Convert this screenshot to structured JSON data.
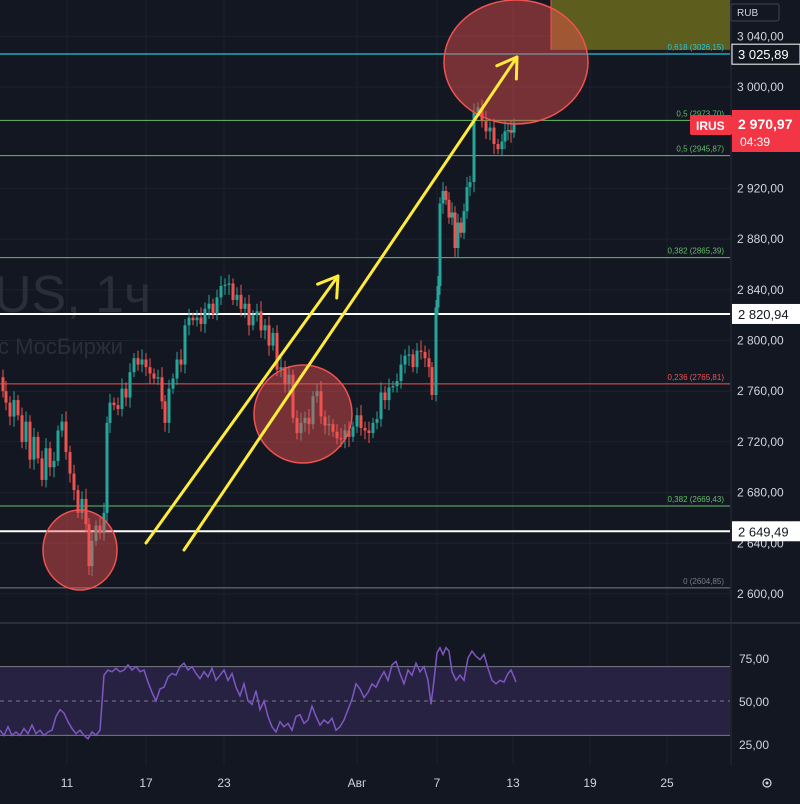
{
  "currency_badge": "RUB",
  "watermark": {
    "line1": "US, 1ч",
    "line2": "с МосБиржи"
  },
  "settings_icon": "gear-icon",
  "ticker": {
    "symbol": "IRUS",
    "price": "2 970,97",
    "countdown": "04:39"
  },
  "colors": {
    "background": "#131722",
    "bull": "#26a69a",
    "bear": "#ef5350",
    "grid": "#1e222d",
    "rsi": "#7e57c2",
    "rsi_band": "#2a2346",
    "arrow": "#ffeb3b",
    "circle_fill": "rgba(239,83,80,0.45)",
    "circle_stroke": "#ef5350",
    "target_box": "#6b6a1c"
  },
  "chart_data": [
    {
      "type": "candlestick",
      "title": "",
      "currency": "RUB",
      "x_tick_labels": [
        "11",
        "17",
        "23",
        "Авг",
        "7",
        "13",
        "19",
        "25"
      ],
      "y_axis": {
        "range": [
          2585,
          3060
        ],
        "tick_values": [
          2600,
          2640,
          2680,
          2720,
          2760,
          2800,
          2840,
          2880,
          2920,
          3000,
          3040
        ],
        "tick_labels": [
          "2 600,00",
          "2 640,00",
          "2 680,00",
          "2 720,00",
          "2 760,00",
          "2 800,00",
          "2 840,00",
          "2 880,00",
          "2 920,00",
          "3 000,00",
          "3 040,00"
        ]
      },
      "horizontal_levels": [
        {
          "value": 3025.89,
          "label": "3 025,89",
          "color": "#26c6da"
        },
        {
          "value": 2820.94,
          "label": "2 820,94",
          "color": "#ffffff"
        },
        {
          "value": 2649.49,
          "label": "2 649,49",
          "color": "#ffffff"
        }
      ],
      "fib_levels": [
        {
          "value": 3026.15,
          "label": "0,618 (3026,15)",
          "color": "#26c6da"
        },
        {
          "value": 2973.7,
          "label": "0,5 (2973,70)",
          "color": "#66bb6a"
        },
        {
          "value": 2945.87,
          "label": "0,5 (2945,87)",
          "color": "#66bb6a"
        },
        {
          "value": 2865.39,
          "label": "0,382 (2865,39)",
          "color": "#66bb6a"
        },
        {
          "value": 2765.81,
          "label": "0,236 (2765,81)",
          "color": "#ef5350"
        },
        {
          "value": 2669.43,
          "label": "0,382 (2669,43)",
          "color": "#66bb6a"
        },
        {
          "value": 2604.85,
          "label": "0 (2604,85)",
          "color": "#787b86"
        }
      ],
      "last_price": 2970.97,
      "price_path": [
        [
          0,
          2771
        ],
        [
          3,
          2760
        ],
        [
          6,
          2751
        ],
        [
          10,
          2740
        ],
        [
          14,
          2753
        ],
        [
          18,
          2741
        ],
        [
          22,
          2720
        ],
        [
          26,
          2736
        ],
        [
          30,
          2706
        ],
        [
          34,
          2724
        ],
        [
          38,
          2707
        ],
        [
          42,
          2690
        ],
        [
          46,
          2715
        ],
        [
          50,
          2700
        ],
        [
          54,
          2705
        ],
        [
          58,
          2729
        ],
        [
          62,
          2736
        ],
        [
          66,
          2712
        ],
        [
          70,
          2695
        ],
        [
          74,
          2682
        ],
        [
          78,
          2664
        ],
        [
          82,
          2675
        ],
        [
          86,
          2655
        ],
        [
          89,
          2622
        ],
        [
          92,
          2642
        ],
        [
          96,
          2654
        ],
        [
          100,
          2648
        ],
        [
          104,
          2664
        ],
        [
          107,
          2735
        ],
        [
          110,
          2751
        ],
        [
          114,
          2749
        ],
        [
          118,
          2746
        ],
        [
          122,
          2762
        ],
        [
          126,
          2755
        ],
        [
          130,
          2775
        ],
        [
          134,
          2786
        ],
        [
          138,
          2781
        ],
        [
          142,
          2785
        ],
        [
          146,
          2779
        ],
        [
          150,
          2774
        ],
        [
          154,
          2770
        ],
        [
          158,
          2771
        ],
        [
          162,
          2752
        ],
        [
          165,
          2735
        ],
        [
          169,
          2762
        ],
        [
          173,
          2770
        ],
        [
          177,
          2785
        ],
        [
          181,
          2781
        ],
        [
          185,
          2812
        ],
        [
          189,
          2818
        ],
        [
          193,
          2816
        ],
        [
          197,
          2818
        ],
        [
          201,
          2813
        ],
        [
          205,
          2825
        ],
        [
          209,
          2829
        ],
        [
          213,
          2821
        ],
        [
          217,
          2834
        ],
        [
          221,
          2843
        ],
        [
          225,
          2844
        ],
        [
          229,
          2845
        ],
        [
          233,
          2832
        ],
        [
          237,
          2836
        ],
        [
          241,
          2825
        ],
        [
          245,
          2829
        ],
        [
          249,
          2812
        ],
        [
          253,
          2820
        ],
        [
          257,
          2823
        ],
        [
          261,
          2808
        ],
        [
          265,
          2812
        ],
        [
          269,
          2796
        ],
        [
          273,
          2806
        ],
        [
          277,
          2777
        ],
        [
          281,
          2779
        ],
        [
          285,
          2766
        ],
        [
          289,
          2773
        ],
        [
          293,
          2739
        ],
        [
          297,
          2727
        ],
        [
          301,
          2735
        ],
        [
          305,
          2739
        ],
        [
          309,
          2734
        ],
        [
          313,
          2756
        ],
        [
          317,
          2760
        ],
        [
          321,
          2740
        ],
        [
          325,
          2733
        ],
        [
          329,
          2734
        ],
        [
          333,
          2728
        ],
        [
          337,
          2723
        ],
        [
          341,
          2722
        ],
        [
          345,
          2729
        ],
        [
          349,
          2724
        ],
        [
          353,
          2732
        ],
        [
          357,
          2741
        ],
        [
          361,
          2731
        ],
        [
          365,
          2729
        ],
        [
          369,
          2727
        ],
        [
          373,
          2735
        ],
        [
          377,
          2738
        ],
        [
          381,
          2759
        ],
        [
          385,
          2753
        ],
        [
          389,
          2763
        ],
        [
          393,
          2764
        ],
        [
          397,
          2768
        ],
        [
          401,
          2781
        ],
        [
          405,
          2788
        ],
        [
          409,
          2789
        ],
        [
          413,
          2779
        ],
        [
          417,
          2792
        ],
        [
          421,
          2791
        ],
        [
          425,
          2786
        ],
        [
          429,
          2779
        ],
        [
          432,
          2757
        ],
        [
          436,
          2826
        ],
        [
          438,
          2843
        ],
        [
          440,
          2908
        ],
        [
          443,
          2918
        ],
        [
          446,
          2911
        ],
        [
          449,
          2897
        ],
        [
          452,
          2901
        ],
        [
          455,
          2873
        ],
        [
          458,
          2893
        ],
        [
          461,
          2885
        ],
        [
          464,
          2902
        ],
        [
          467,
          2921
        ],
        [
          470,
          2925
        ],
        [
          474,
          2980
        ],
        [
          478,
          2984
        ],
        [
          482,
          2973
        ],
        [
          486,
          2965
        ],
        [
          490,
          2968
        ],
        [
          494,
          2955
        ],
        [
          498,
          2951
        ],
        [
          502,
          2957
        ],
        [
          505,
          2965
        ],
        [
          508,
          2966
        ],
        [
          511,
          2964
        ],
        [
          514,
          2971
        ]
      ]
    },
    {
      "type": "line",
      "title": "",
      "series": [
        {
          "values": [
            [
              0,
              33
            ],
            [
              4,
              30
            ],
            [
              8,
              35
            ],
            [
              12,
              30
            ],
            [
              16,
              32
            ],
            [
              20,
              30
            ],
            [
              24,
              34
            ],
            [
              28,
              31
            ],
            [
              32,
              36
            ],
            [
              36,
              31
            ],
            [
              40,
              33
            ],
            [
              44,
              30
            ],
            [
              48,
              32
            ],
            [
              52,
              33
            ],
            [
              56,
              41
            ],
            [
              60,
              45
            ],
            [
              64,
              43
            ],
            [
              68,
              38
            ],
            [
              72,
              34
            ],
            [
              76,
              31
            ],
            [
              80,
              33
            ],
            [
              84,
              30
            ],
            [
              88,
              28
            ],
            [
              92,
              32
            ],
            [
              96,
              30
            ],
            [
              100,
              33
            ],
            [
              104,
              65
            ],
            [
              108,
              68
            ],
            [
              112,
              67
            ],
            [
              116,
              69
            ],
            [
              120,
              67
            ],
            [
              124,
              68
            ],
            [
              128,
              71
            ],
            [
              132,
              68
            ],
            [
              136,
              70
            ],
            [
              140,
              67
            ],
            [
              144,
              68
            ],
            [
              148,
              61
            ],
            [
              152,
              55
            ],
            [
              156,
              50
            ],
            [
              160,
              57
            ],
            [
              164,
              58
            ],
            [
              168,
              64
            ],
            [
              172,
              66
            ],
            [
              176,
              65
            ],
            [
              180,
              70
            ],
            [
              184,
              72
            ],
            [
              188,
              68
            ],
            [
              192,
              70
            ],
            [
              196,
              66
            ],
            [
              200,
              63
            ],
            [
              204,
              67
            ],
            [
              208,
              64
            ],
            [
              212,
              69
            ],
            [
              216,
              62
            ],
            [
              220,
              65
            ],
            [
              224,
              68
            ],
            [
              228,
              62
            ],
            [
              232,
              66
            ],
            [
              236,
              58
            ],
            [
              240,
              53
            ],
            [
              244,
              60
            ],
            [
              248,
              50
            ],
            [
              252,
              48
            ],
            [
              256,
              56
            ],
            [
              260,
              45
            ],
            [
              264,
              50
            ],
            [
              268,
              41
            ],
            [
              272,
              35
            ],
            [
              276,
              32
            ],
            [
              280,
              38
            ],
            [
              284,
              35
            ],
            [
              288,
              37
            ],
            [
              292,
              33
            ],
            [
              296,
              41
            ],
            [
              300,
              42
            ],
            [
              304,
              37
            ],
            [
              308,
              39
            ],
            [
              312,
              47
            ],
            [
              316,
              41
            ],
            [
              320,
              36
            ],
            [
              324,
              39
            ],
            [
              328,
              37
            ],
            [
              332,
              40
            ],
            [
              336,
              33
            ],
            [
              340,
              35
            ],
            [
              344,
              39
            ],
            [
              348,
              45
            ],
            [
              352,
              51
            ],
            [
              356,
              60
            ],
            [
              360,
              57
            ],
            [
              364,
              52
            ],
            [
              368,
              55
            ],
            [
              372,
              60
            ],
            [
              376,
              58
            ],
            [
              380,
              63
            ],
            [
              384,
              67
            ],
            [
              388,
              62
            ],
            [
              392,
              71
            ],
            [
              396,
              73
            ],
            [
              400,
              66
            ],
            [
              404,
              60
            ],
            [
              408,
              68
            ],
            [
              412,
              65
            ],
            [
              416,
              72
            ],
            [
              420,
              67
            ],
            [
              424,
              70
            ],
            [
              428,
              62
            ],
            [
              431,
              48
            ],
            [
              434,
              62
            ],
            [
              437,
              78
            ],
            [
              440,
              81
            ],
            [
              443,
              77
            ],
            [
              446,
              81
            ],
            [
              449,
              79
            ],
            [
              452,
              67
            ],
            [
              456,
              62
            ],
            [
              460,
              65
            ],
            [
              464,
              62
            ],
            [
              468,
              75
            ],
            [
              472,
              79
            ],
            [
              476,
              76
            ],
            [
              480,
              74
            ],
            [
              484,
              77
            ],
            [
              488,
              69
            ],
            [
              492,
              62
            ],
            [
              496,
              60
            ],
            [
              500,
              62
            ],
            [
              504,
              61
            ],
            [
              508,
              66
            ],
            [
              511,
              68
            ],
            [
              514,
              64
            ],
            [
              516,
              61
            ]
          ]
        }
      ],
      "y_axis": {
        "range": [
          22,
          84
        ],
        "tick_values": [
          25,
          50,
          75
        ],
        "tick_labels": [
          "25,00",
          "50,00",
          "75,00"
        ]
      },
      "band": [
        30,
        70
      ],
      "midline": 50
    }
  ]
}
